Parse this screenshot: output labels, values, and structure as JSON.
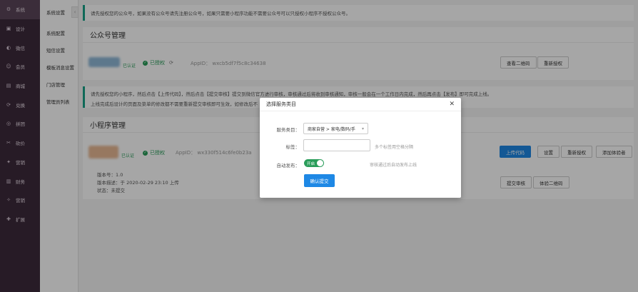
{
  "sidebar": {
    "items": [
      {
        "label": "系统",
        "icon": "gear-icon",
        "glyph": "⚙"
      },
      {
        "label": "设计",
        "icon": "design-icon",
        "glyph": "▣"
      },
      {
        "label": "微信",
        "icon": "wechat-icon",
        "glyph": "◐"
      },
      {
        "label": "会员",
        "icon": "member-icon",
        "glyph": "☺"
      },
      {
        "label": "商城",
        "icon": "mall-icon",
        "glyph": "▤"
      },
      {
        "label": "兑换",
        "icon": "exchange-icon",
        "glyph": "⟳"
      },
      {
        "label": "拼团",
        "icon": "group-icon",
        "glyph": "◎"
      },
      {
        "label": "砍价",
        "icon": "bargain-icon",
        "glyph": "✂"
      },
      {
        "label": "营销",
        "icon": "marketing-icon",
        "glyph": "✦"
      },
      {
        "label": "财务",
        "icon": "finance-icon",
        "glyph": "▥"
      },
      {
        "label": "营销",
        "icon": "promo-icon",
        "glyph": "✧"
      },
      {
        "label": "扩展",
        "icon": "extend-icon",
        "glyph": "✚"
      }
    ]
  },
  "submenu": {
    "items": [
      "系统设置",
      "系统配置",
      "短信设置",
      "模板消息设置",
      "门店管理",
      "管理员列表"
    ]
  },
  "notice1": "请先授权您的公众号，如果没有公众号请先注册公众号，如果只需要小程序功能不需要公众号可以只授权小程序不授权公众号。",
  "official": {
    "title": "公众号管理",
    "verified": "已认证",
    "auth": "已授权",
    "appid": "AppID： wxcb5df7f5c8c34638",
    "btn_qrcode": "查看二维码",
    "btn_reauth": "重新授权"
  },
  "notice2": {
    "line1": "请先授权您的小程序，然后点击【上传代码】，然后点击【提交审核】提交到微信官方进行审核，审核通过后将收到审核通知，审核一般会在一个工作日内完成，然后再点击【发布】即可完成上线。",
    "line2": "上线完成后设计的页面及菜单的修改都不需要重新提交审核即可生效，如修改后不"
  },
  "mini": {
    "title": "小程序管理",
    "verified": "已认证",
    "auth": "已授权",
    "appid": "AppID： wx330f514c6fe0b23a",
    "version": "版本号：1.0",
    "desc": "版本描述：于 2020-02-29 23:10 上传",
    "status": "状态：未提交",
    "btn_upload": "上传代码",
    "btn_settings": "设置",
    "btn_reauth": "重新授权",
    "btn_add_tester": "添加体验者",
    "btn_submit_audit": "提交审核",
    "btn_qrcode": "体验二维码"
  },
  "modal": {
    "title": "选择服务类目",
    "category_label": "服务类目：",
    "category_value": "商家自营 > 家电/数码/手",
    "tags_label": "标签：",
    "tags_hint": "多个标签用空格分隔",
    "autopub_label": "自动发布：",
    "toggle_on": "开启",
    "autopub_hint": "审核通过后自动发布上线",
    "submit": "确认提交"
  },
  "colors": {
    "accent": "#1e88e5",
    "success": "#2a9d5a",
    "sidebar": "#3d2a3b"
  }
}
